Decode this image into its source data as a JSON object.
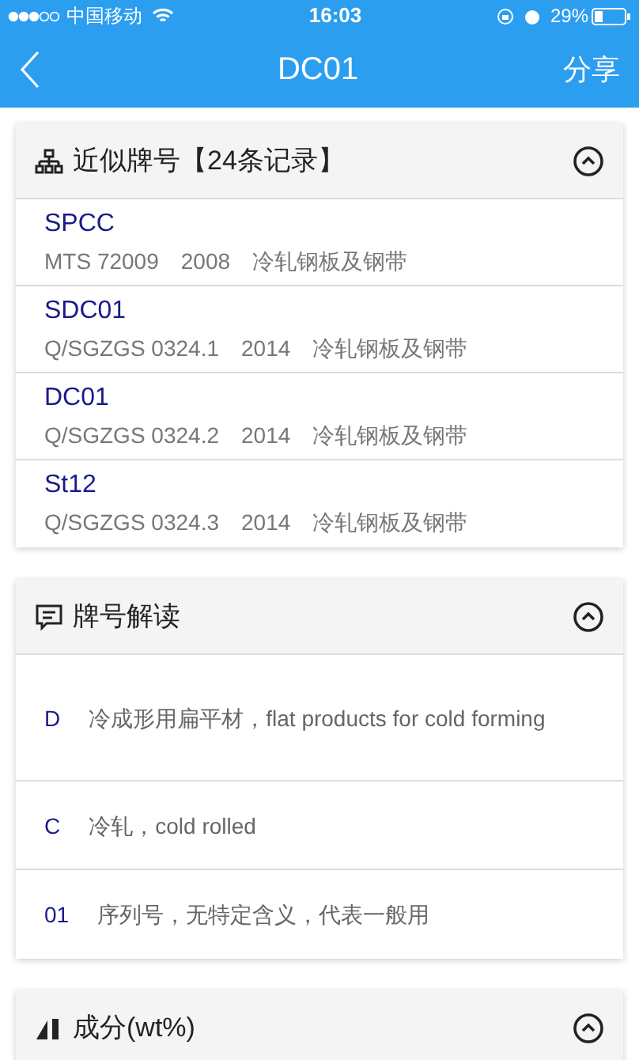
{
  "status_bar": {
    "carrier": "中国移动",
    "time": "16:03",
    "battery": "29%"
  },
  "nav": {
    "title": "DC01",
    "action": "分享"
  },
  "sections": [
    {
      "kind": "records",
      "title": "近似牌号【24条记录】",
      "expanded": true,
      "items": [
        {
          "name": "SPCC",
          "detail": "MTS 72009　2008　冷轧钢板及钢带"
        },
        {
          "name": "SDC01",
          "detail": "Q/SGZGS 0324.1　2014　冷轧钢板及钢带"
        },
        {
          "name": "DC01",
          "detail": "Q/SGZGS 0324.2　2014　冷轧钢板及钢带"
        },
        {
          "name": "St12",
          "detail": "Q/SGZGS 0324.3　2014　冷轧钢板及钢带"
        }
      ]
    },
    {
      "kind": "interpretation",
      "title": "牌号解读",
      "expanded": true,
      "items": [
        {
          "code": "D",
          "meaning": "冷成形用扁平材，flat products for cold forming"
        },
        {
          "code": "C",
          "meaning": "冷轧，cold rolled"
        },
        {
          "code": "01",
          "meaning": "序列号，无特定含义，代表一般用"
        }
      ]
    },
    {
      "kind": "composition",
      "title": "成分(wt%)",
      "expanded": true
    }
  ]
}
